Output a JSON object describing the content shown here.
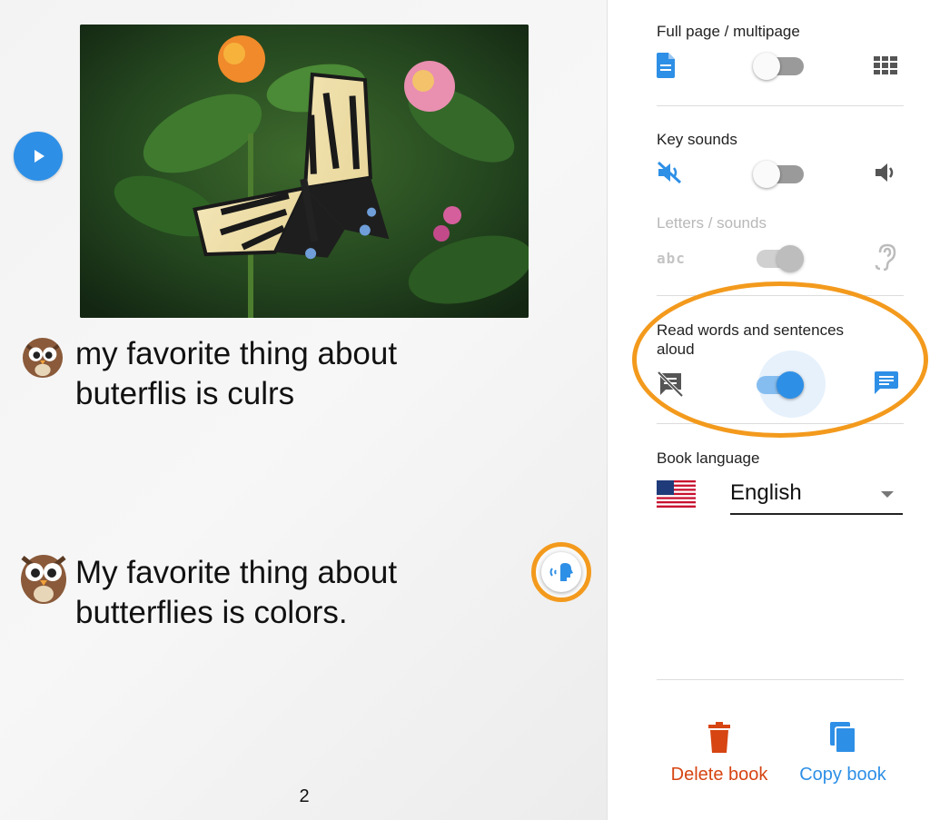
{
  "book": {
    "student_sentence": "my favorite thing about buterflis is culrs",
    "corrected_sentence": "My favorite thing about butterflies is colors.",
    "page_number": "2",
    "image_subject": "butterfly-photo"
  },
  "settings": {
    "full_page": {
      "label": "Full page / multipage",
      "state": "off",
      "icon_left": "document-icon",
      "icon_right": "grid-icon"
    },
    "key_sounds": {
      "label": "Key sounds",
      "state": "off",
      "icon_left": "mute-icon",
      "icon_right": "volume-icon"
    },
    "letters_sounds": {
      "label": "Letters / sounds",
      "state": "on-disabled",
      "icon_left": "abc-icon",
      "icon_right": "ear-icon"
    },
    "read_aloud": {
      "label": "Read words and sentences aloud",
      "state": "on",
      "icon_left": "comment-off-icon",
      "icon_right": "comment-icon"
    },
    "book_language": {
      "label": "Book language",
      "value": "English",
      "flag": "us-flag"
    }
  },
  "actions": {
    "delete_label": "Delete book",
    "copy_label": "Copy book"
  },
  "colors": {
    "accent_blue": "#2e8fe6",
    "highlight_orange": "#f39a1d",
    "delete_red": "#d64512"
  }
}
